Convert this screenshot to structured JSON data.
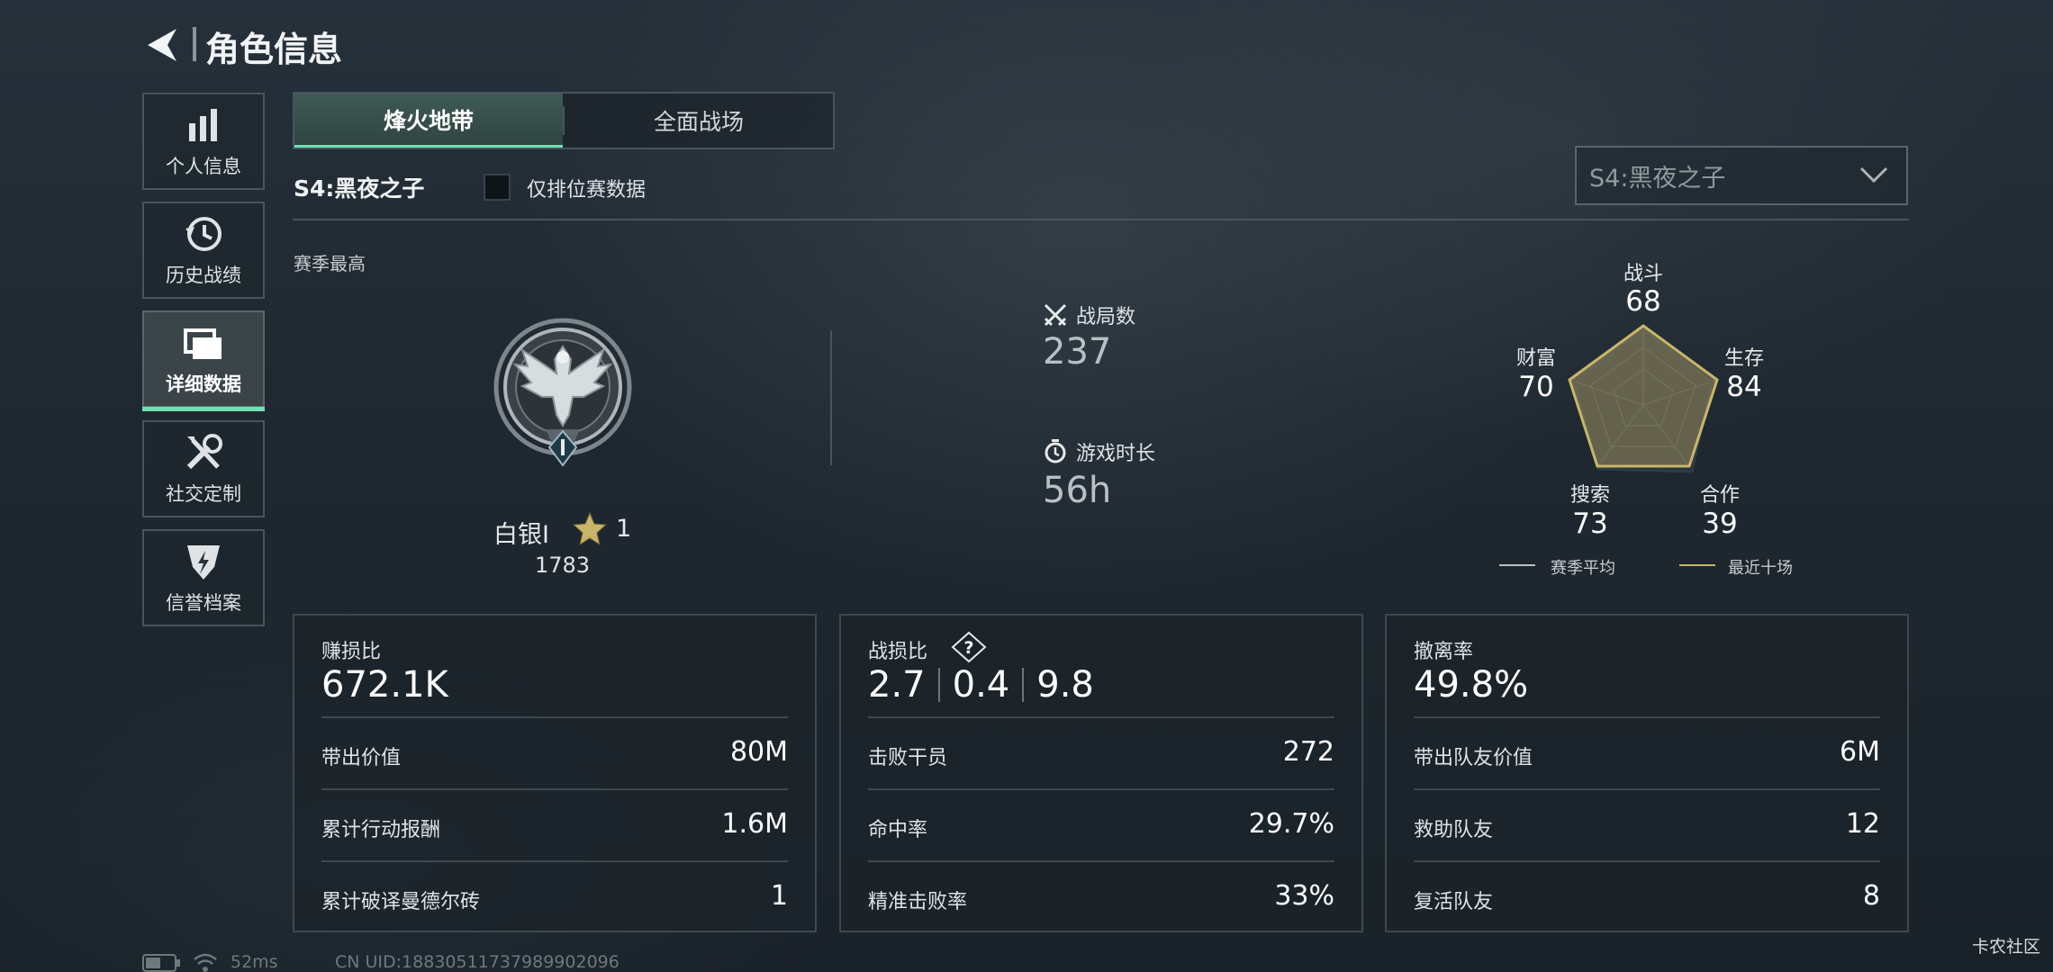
{
  "header": {
    "title": "角色信息"
  },
  "sidebar": {
    "items": [
      {
        "label": "个人信息",
        "icon": "bar-chart-icon"
      },
      {
        "label": "历史战绩",
        "icon": "history-icon"
      },
      {
        "label": "详细数据",
        "icon": "folder-icon"
      },
      {
        "label": "社交定制",
        "icon": "tools-icon"
      },
      {
        "label": "信誉档案",
        "icon": "badge-icon"
      }
    ],
    "active_index": 2
  },
  "tabs": [
    {
      "label": "烽火地带"
    },
    {
      "label": "全面战场"
    }
  ],
  "season": {
    "name": "S4:黑夜之子",
    "ranked_only_label": "仅排位赛数据",
    "selector_value": "S4:黑夜之子"
  },
  "overview": {
    "season_best_label": "赛季最高",
    "rank_name": "白银Ⅰ",
    "rank_stars": "1",
    "rank_score": "1783",
    "matches_label": "战局数",
    "matches_value": "237",
    "playtime_label": "游戏时长",
    "playtime_value": "56h"
  },
  "radar": {
    "axes": [
      {
        "label": "战斗",
        "value": "68"
      },
      {
        "label": "生存",
        "value": "84"
      },
      {
        "label": "合作",
        "value": "39"
      },
      {
        "label": "搜索",
        "value": "73"
      },
      {
        "label": "财富",
        "value": "70"
      }
    ],
    "legend": [
      {
        "label": "赛季平均"
      },
      {
        "label": "最近十场"
      }
    ]
  },
  "cards": {
    "profit": {
      "title": "赚损比",
      "value": "672.1K",
      "rows": [
        {
          "label": "带出价值",
          "value": "80M"
        },
        {
          "label": "累计行动报酬",
          "value": "1.6M"
        },
        {
          "label": "累计破译曼德尔砖",
          "value": "1"
        }
      ]
    },
    "kd": {
      "title": "战损比",
      "help": "?",
      "parts": [
        "2.7",
        "0.4",
        "9.8"
      ],
      "rows": [
        {
          "label": "击败干员",
          "value": "272"
        },
        {
          "label": "命中率",
          "value": "29.7%"
        },
        {
          "label": "精准击败率",
          "value": "33%"
        }
      ]
    },
    "extract": {
      "title": "撤离率",
      "value": "49.8%",
      "rows": [
        {
          "label": "带出队友价值",
          "value": "6M"
        },
        {
          "label": "救助队友",
          "value": "12"
        },
        {
          "label": "复活队友",
          "value": "8"
        }
      ]
    }
  },
  "status_bar": {
    "ping": "52ms",
    "uid": "CN UID:18830511737989902096"
  },
  "watermark": "卡农社区",
  "colors": {
    "accent": "#6fe0b2",
    "radar_recent": "#c9b56a",
    "radar_average": "#2e3a46"
  }
}
